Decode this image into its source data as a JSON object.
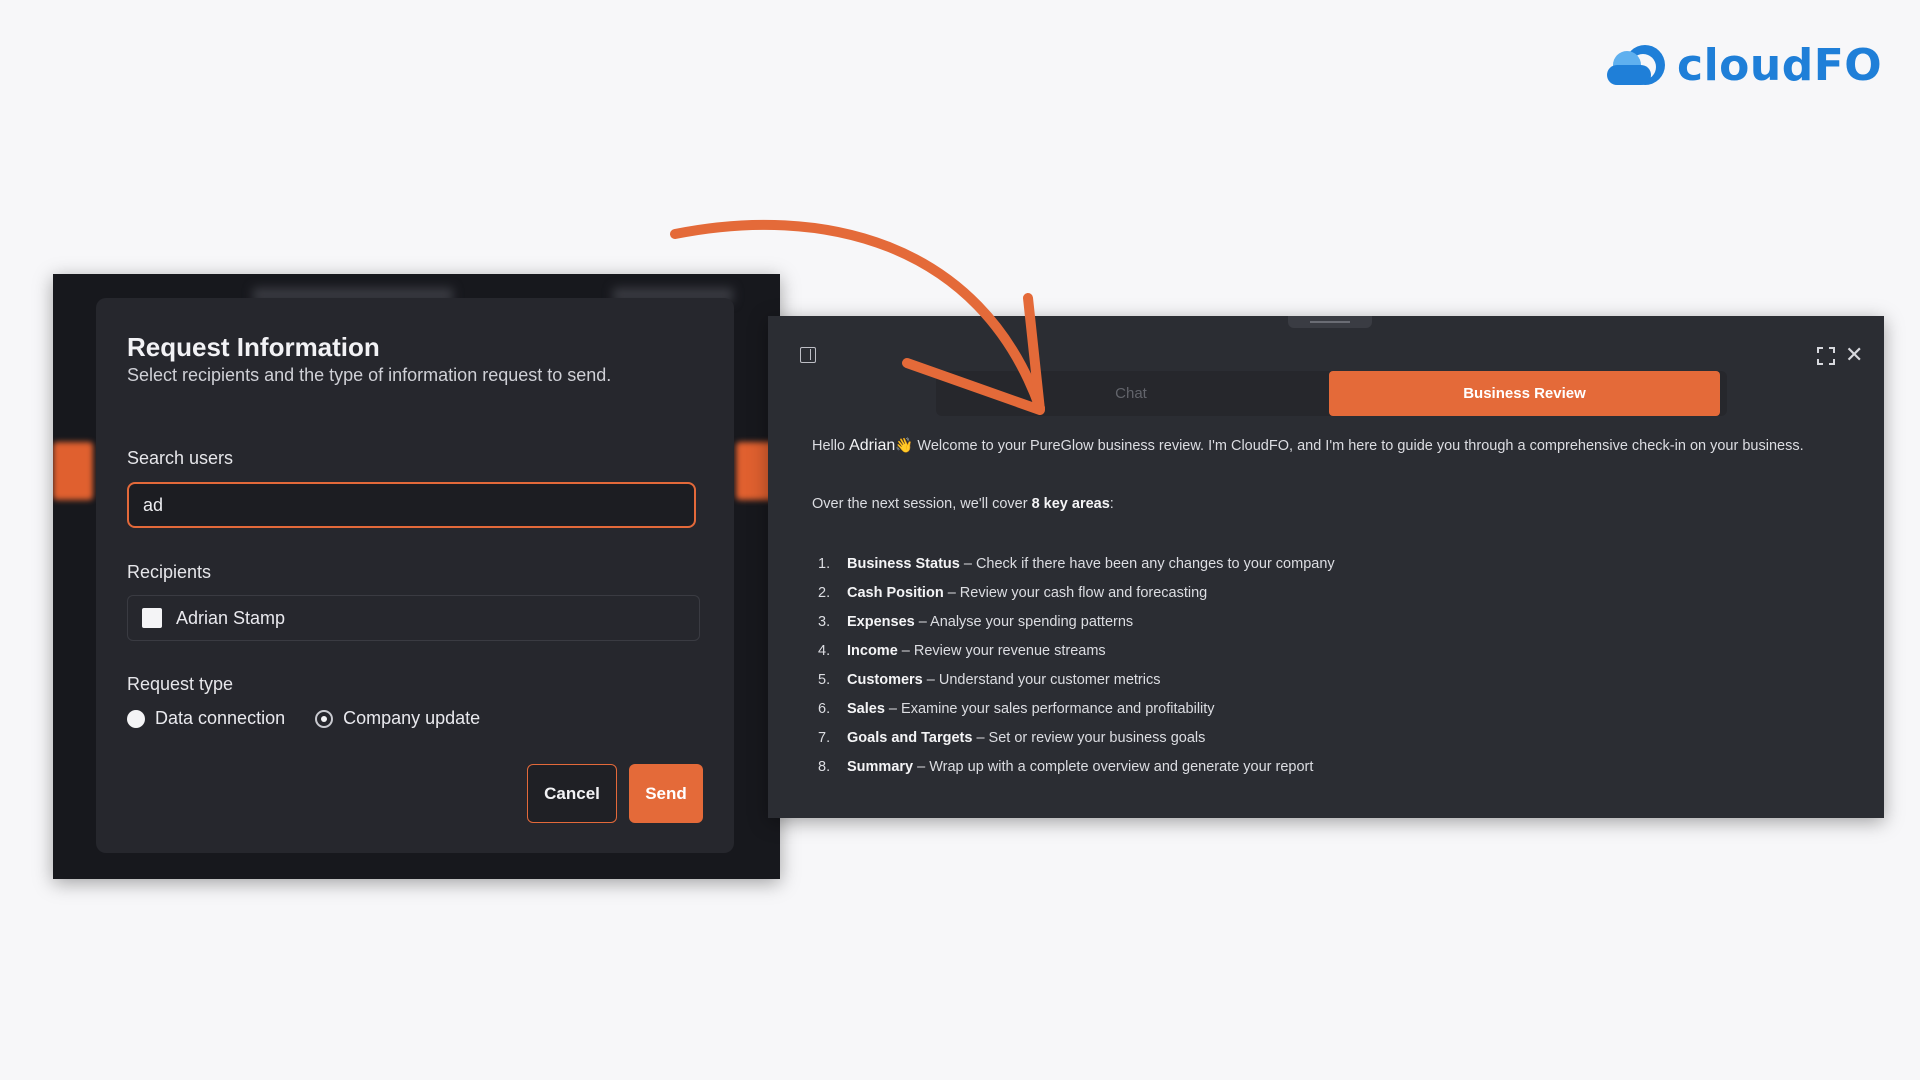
{
  "brand": {
    "name": "cloudFO",
    "color": "#1f7fd8",
    "accent": "#e46a39"
  },
  "modal": {
    "title": "Request Information",
    "subtitle": "Select recipients and the type of information request to send.",
    "search_label": "Search users",
    "search_value": "ad",
    "recipients_label": "Recipients",
    "recipients": [
      {
        "name": "Adrian Stamp",
        "checked": false
      }
    ],
    "request_type_label": "Request type",
    "request_types": [
      {
        "label": "Data connection",
        "selected": false
      },
      {
        "label": "Company update",
        "selected": true
      }
    ],
    "cancel_label": "Cancel",
    "send_label": "Send"
  },
  "chat": {
    "tabs": [
      {
        "label": "Chat",
        "active": false
      },
      {
        "label": "Business Review",
        "active": true
      }
    ],
    "greeting_prefix": "Hello",
    "greeting_name": "Adrian",
    "greeting_emoji": "👋",
    "greeting_text": "Welcome to your PureGlow business review. I'm CloudFO, and I'm here to guide you through a comprehensive check-in on your business.",
    "cover_prefix": "Over the next session, we'll cover",
    "cover_bold": "8 key areas",
    "cover_suffix": ":",
    "areas": [
      {
        "num": "1.",
        "title": "Business Status",
        "desc": " – Check if there have been any changes to your company"
      },
      {
        "num": "2.",
        "title": "Cash Position",
        "desc": " – Review your cash flow and forecasting"
      },
      {
        "num": "3.",
        "title": "Expenses",
        "desc": " – Analyse your spending patterns"
      },
      {
        "num": "4.",
        "title": "Income",
        "desc": " – Review your revenue streams"
      },
      {
        "num": "5.",
        "title": "Customers",
        "desc": " – Understand your customer metrics"
      },
      {
        "num": "6.",
        "title": "Sales",
        "desc": " – Examine your sales performance and profitability"
      },
      {
        "num": "7.",
        "title": "Goals and Targets",
        "desc": " – Set or review your business goals"
      },
      {
        "num": "8.",
        "title": "Summary",
        "desc": " – Wrap up with a complete overview and generate your report"
      }
    ]
  },
  "icons": {
    "logo": "cloud-logo-icon",
    "sidebar": "sidebar-toggle-icon",
    "expand": "expand-icon",
    "close": "close-icon",
    "arrow": "curved-arrow-icon"
  }
}
